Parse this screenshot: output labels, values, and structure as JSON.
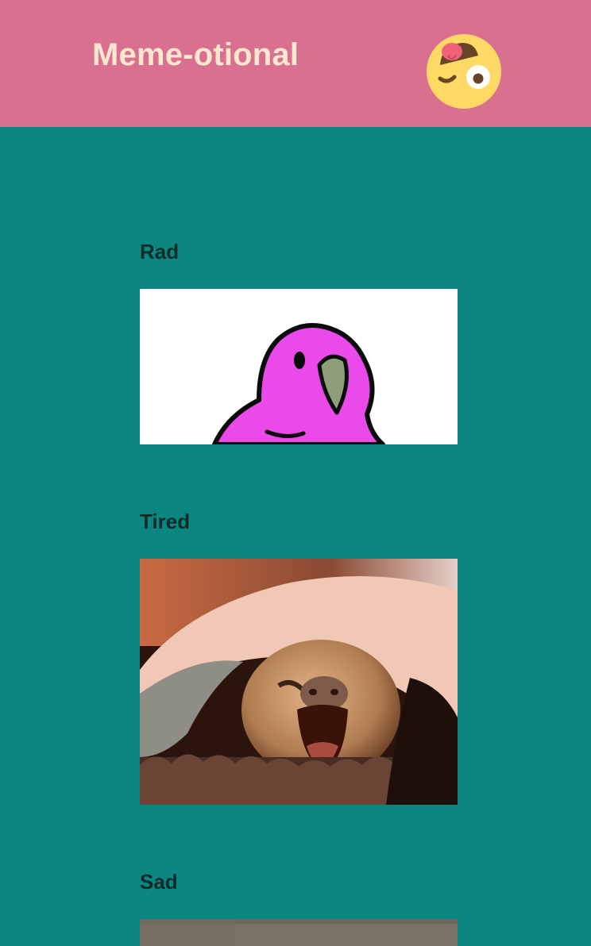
{
  "header": {
    "title": "Meme-otional",
    "logo_icon": "winking-face-with-tongue-icon"
  },
  "colors": {
    "header_bg": "#d97090",
    "page_bg": "#0b8680",
    "title_text": "#fde7cf",
    "heading_text": "#0f2b2a"
  },
  "sections": [
    {
      "heading": "Rad",
      "image": "party-parrot-gif"
    },
    {
      "heading": "Tired",
      "image": "yawning-sloth-gif"
    },
    {
      "heading": "Sad",
      "image": "sad-gif"
    }
  ]
}
